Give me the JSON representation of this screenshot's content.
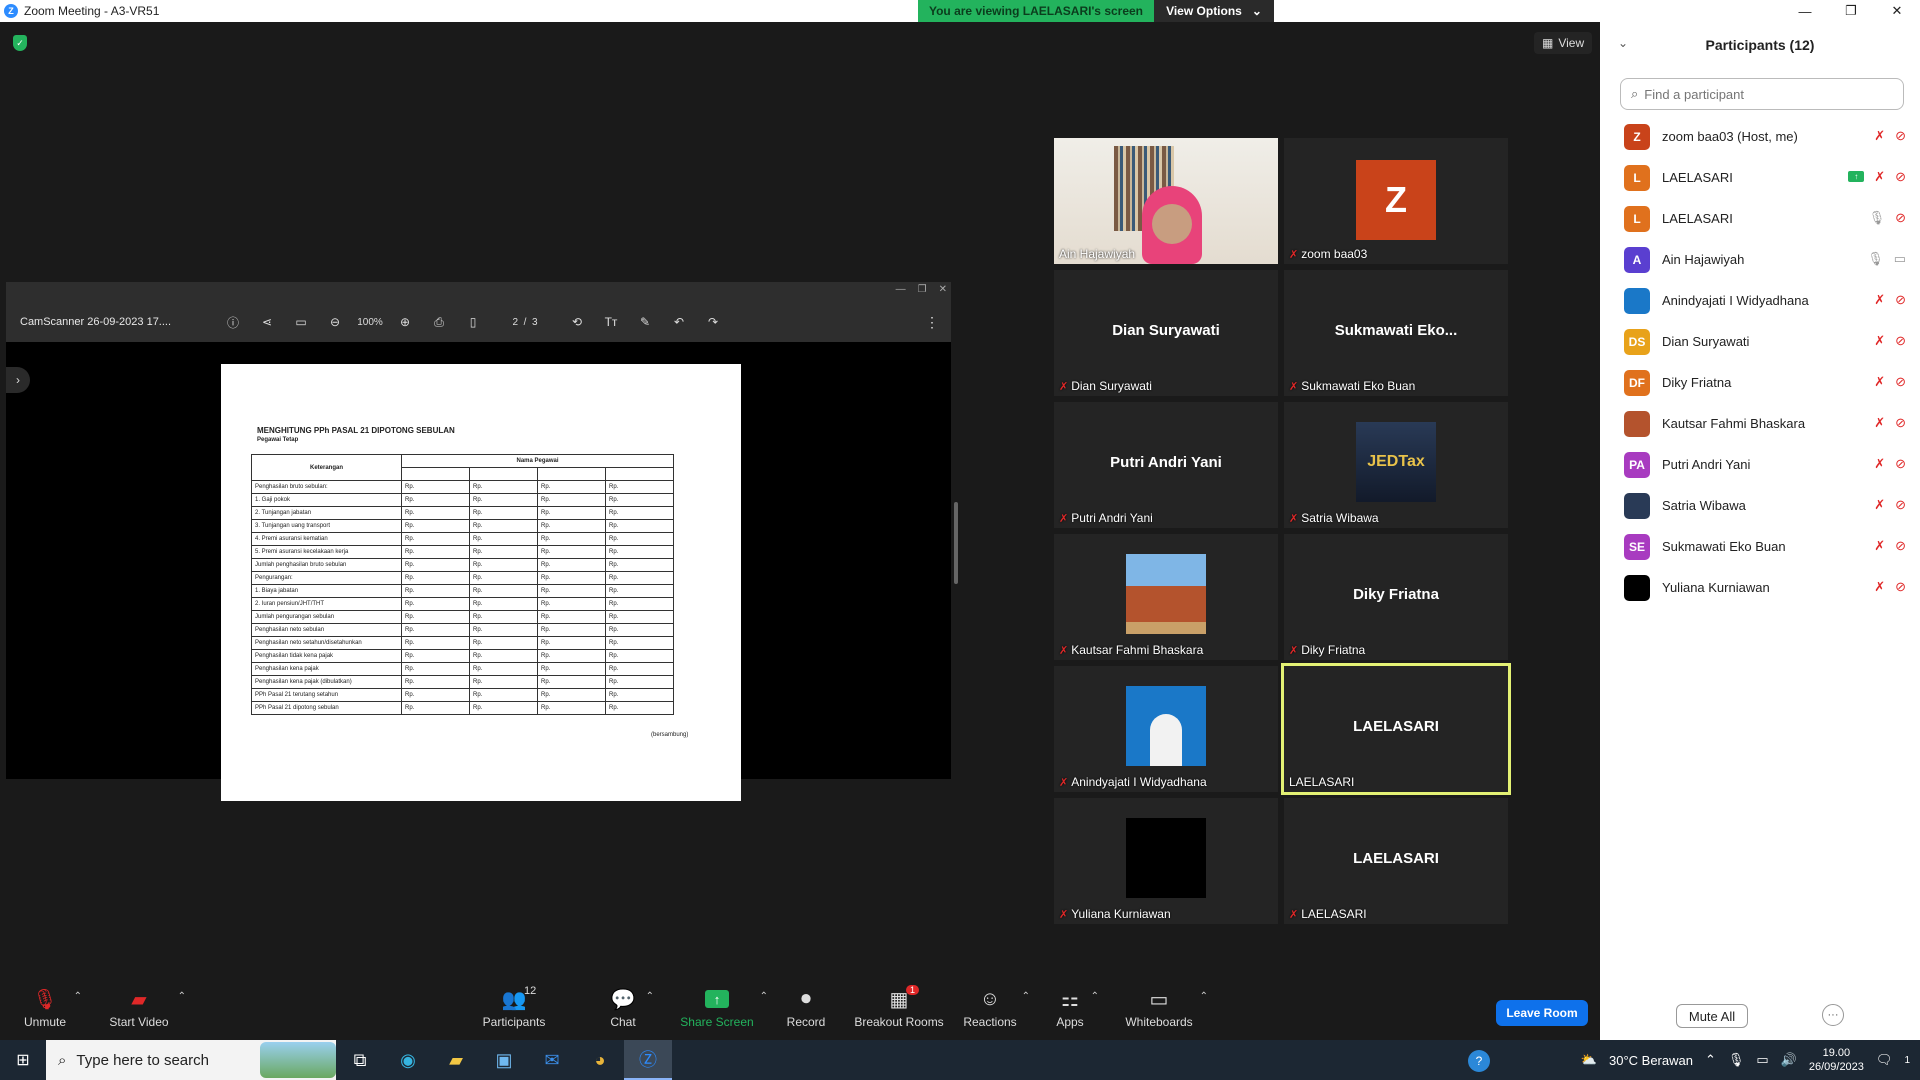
{
  "window": {
    "title": "Zoom Meeting - A3-VR51",
    "controls": [
      "—",
      "❐",
      "✕"
    ]
  },
  "banner": {
    "message": "You are viewing LAELASARI's screen",
    "options_label": "View Options"
  },
  "stage": {
    "view_label": "View"
  },
  "shared_screen": {
    "app_title": "CamScanner 26-09-2023 17....",
    "zoom": "100%",
    "page_current": "2",
    "page_total": "3",
    "document": {
      "heading": "MENGHITUNG PPh PASAL 21 DIPOTONG SEBULAN",
      "subheading": "Pegawai Tetap",
      "col_header": "Keterangan",
      "group_header": "Nama Pegawai",
      "rows": [
        "Penghasilan bruto sebulan:",
        "1. Gaji pokok",
        "2. Tunjangan jabatan",
        "3. Tunjangan uang transport",
        "4. Premi asuransi kematian",
        "5. Premi asuransi kecelakaan kerja",
        "Jumlah penghasilan bruto sebulan",
        "Pengurangan:",
        "1. Biaya jabatan",
        "2. Iuran pensiun/JHT/THT",
        "Jumlah pengurangan sebulan",
        "Penghasilan neto sebulan",
        "Penghasilan neto setahun/disetahunkan",
        "Penghasilan tidak kena pajak",
        "Penghasilan kena pajak",
        "Penghasilan kena pajak (dibulatkan)",
        "PPh Pasal 21 terutang setahun",
        "PPh Pasal 21 dipotong sebulan"
      ],
      "cell_prefix": "Rp.",
      "footer": "(bersambung)"
    }
  },
  "tiles": [
    {
      "name": "Ain Hajawiyah",
      "muted": false
    },
    {
      "name": "zoom baa03",
      "muted": true,
      "avatar_letter": "Z"
    },
    {
      "name": "Dian Suryawati",
      "muted": true,
      "display": "Dian Suryawati"
    },
    {
      "name": "Sukmawati  Eko Buan",
      "muted": true,
      "display": "Sukmawati   Eko..."
    },
    {
      "name": "Putri Andri Yani",
      "muted": true,
      "display": "Putri Andri Yani"
    },
    {
      "name": "Satria Wibawa",
      "muted": true,
      "logo_text": "JEDTax"
    },
    {
      "name": "Kautsar Fahmi Bhaskara",
      "muted": true
    },
    {
      "name": "Diky Friatna",
      "muted": true,
      "display": "Diky Friatna"
    },
    {
      "name": "Anindyajati I Widyadhana",
      "muted": true
    },
    {
      "name": "LAELASARI",
      "muted": false,
      "display": "LAELASARI"
    },
    {
      "name": "Yuliana Kurniawan",
      "muted": true
    },
    {
      "name": "LAELASARI",
      "muted": true,
      "display": "LAELASARI"
    }
  ],
  "panel": {
    "title": "Participants (12)",
    "search_placeholder": "Find a participant",
    "participants": [
      {
        "initials": "Z",
        "name": "zoom baa03 (Host, me)",
        "color": "#c9431a"
      },
      {
        "initials": "L",
        "name": "LAELASARI",
        "color": "#e0711d"
      },
      {
        "initials": "L",
        "name": "LAELASARI",
        "color": "#e0711d"
      },
      {
        "initials": "A",
        "name": "Ain Hajawiyah",
        "color": "#5a3fd0"
      },
      {
        "initials": "",
        "name": "Anindyajati I Widyadhana",
        "color": "#1a78c8"
      },
      {
        "initials": "DS",
        "name": "Dian Suryawati",
        "color": "#e8a21a"
      },
      {
        "initials": "DF",
        "name": "Diky Friatna",
        "color": "#e0711d"
      },
      {
        "initials": "",
        "name": "Kautsar Fahmi Bhaskara",
        "color": "#b4532d"
      },
      {
        "initials": "PA",
        "name": "Putri Andri Yani",
        "color": "#a83bc0"
      },
      {
        "initials": "",
        "name": "Satria Wibawa",
        "color": "#293a56"
      },
      {
        "initials": "SE",
        "name": "Sukmawati  Eko Buan",
        "color": "#a83bc0"
      },
      {
        "initials": "",
        "name": "Yuliana Kurniawan",
        "color": "#000000"
      }
    ],
    "mute_all": "Mute All",
    "more": "···"
  },
  "toolbar": {
    "unmute": "Unmute",
    "start_video": "Start Video",
    "participants": "Participants",
    "participants_count": "12",
    "chat": "Chat",
    "share_screen": "Share Screen",
    "record": "Record",
    "breakout_rooms": "Breakout Rooms",
    "breakout_badge": "1",
    "reactions": "Reactions",
    "apps": "Apps",
    "whiteboards": "Whiteboards",
    "leave": "Leave Room"
  },
  "taskbar": {
    "search_placeholder": "Type here to search",
    "weather": "30°C  Berawan",
    "time": "19.00",
    "date": "26/09/2023",
    "notifications": "1"
  }
}
